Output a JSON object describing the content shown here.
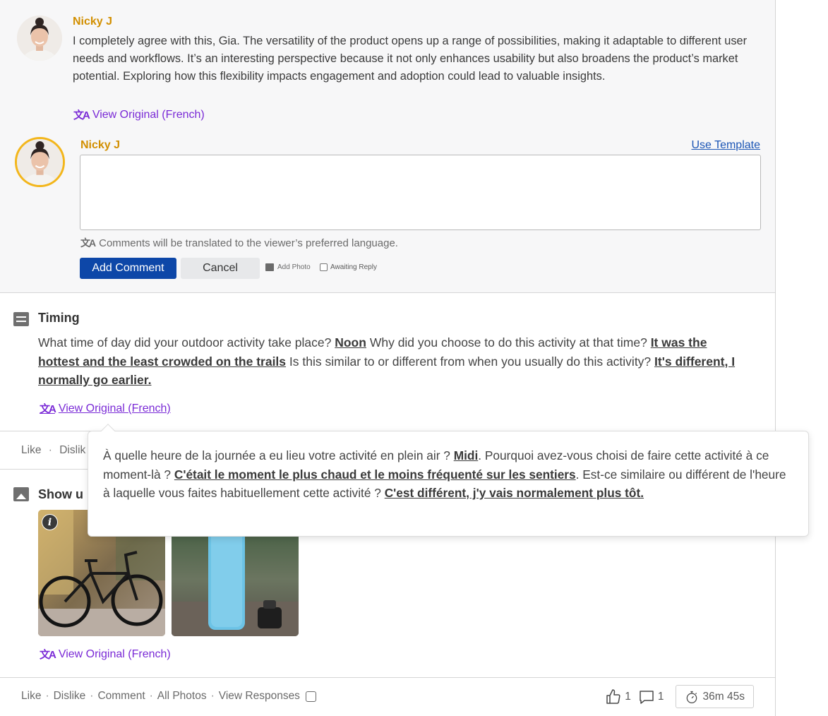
{
  "comment": {
    "author": "Nicky J",
    "text": "I completely agree with this, Gia. The versatility of the product opens up a range of possibilities, making it adaptable to different user needs and workflows. It’s an interesting perspective because it not only enhances usability but also broadens the product’s market potential. Exploring how this flexibility impacts engagement and adoption could lead to valuable insights.",
    "view_original": "View Original (French)"
  },
  "reply": {
    "author": "Nicky J",
    "use_template": "Use Template",
    "input_value": "",
    "input_placeholder": "",
    "translate_note": "Comments will be translated to the viewer’s preferred language.",
    "add_comment": "Add Comment",
    "cancel": "Cancel",
    "add_photo": "Add Photo",
    "awaiting_reply": "Awaiting Reply"
  },
  "timing": {
    "title": "Timing",
    "q1": "What time of day did your outdoor activity take place?",
    "a1": "Noon",
    "q2": "Why did you choose to do this activity at that time?",
    "a2": "It was the hottest and the least crowded on the trails",
    "q3": "Is this similar to or different from when you usually do this activity?",
    "a3": "It's different, I normally go earlier.",
    "view_original": "View Original (French)"
  },
  "popover": {
    "q1": "À quelle heure de la journée a eu lieu votre activité en plein air ?",
    "a1": "Midi",
    "q2": ". Pourquoi avez-vous choisi de faire cette activité à ce moment-là ?",
    "a2": "C'était le moment le plus chaud et le moins fréquenté sur les sentiers",
    "q3": ". Est-ce similaire ou différent de l'heure à laquelle vous faites habituellement cette activité ?",
    "a3": "C'est différent, j'y vais normalement plus tôt."
  },
  "action_bar_1": {
    "like": "Like",
    "sep": "·",
    "dislike_partial": "Dislik"
  },
  "photos": {
    "title_partial": "Show u",
    "view_original": "View Original (French)"
  },
  "action_bar_2": {
    "like": "Like",
    "dislike": "Dislike",
    "comment": "Comment",
    "all_photos": "All Photos",
    "view_responses": "View Responses",
    "sep": "·",
    "likes_count": "1",
    "comments_count": "1",
    "timer": "36m 45s"
  },
  "icons": {
    "translate": "translate-icon",
    "thumbs_up": "thumbs-up-icon",
    "speech_bubble": "comment-icon",
    "stopwatch": "stopwatch-icon"
  },
  "colors": {
    "author": "#d28f00",
    "link_purple": "#7a2ad6",
    "link_blue": "#1b55b5",
    "primary_button": "#0d47a8",
    "avatar_ring": "#f3b61b"
  }
}
